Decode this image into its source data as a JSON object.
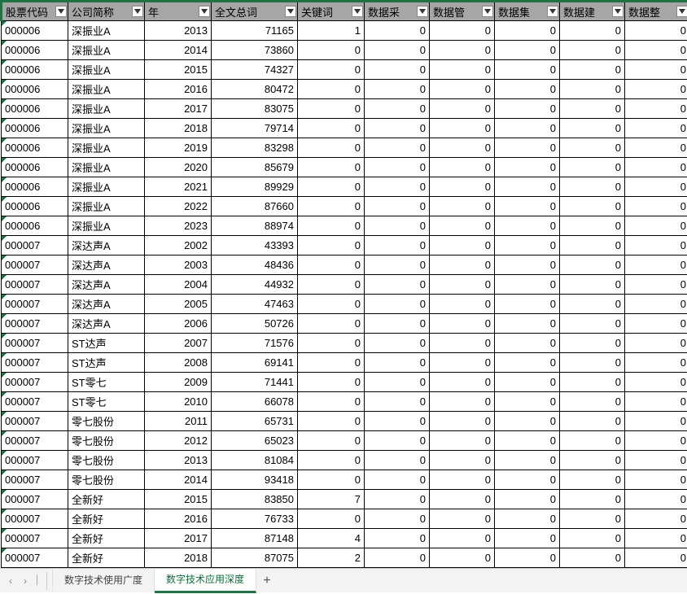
{
  "columns": [
    {
      "key": "code",
      "label": "股票代码",
      "cls": "col-code"
    },
    {
      "key": "name",
      "label": "公司简称",
      "cls": "col-name"
    },
    {
      "key": "year",
      "label": "年",
      "cls": "col-year"
    },
    {
      "key": "words",
      "label": "全文总词",
      "cls": "col-words"
    },
    {
      "key": "kw",
      "label": "关键词",
      "cls": "col-kw"
    },
    {
      "key": "d1",
      "label": "数据采",
      "cls": "col-d"
    },
    {
      "key": "d2",
      "label": "数据管",
      "cls": "col-d"
    },
    {
      "key": "d3",
      "label": "数据集",
      "cls": "col-d"
    },
    {
      "key": "d4",
      "label": "数据建",
      "cls": "col-d"
    },
    {
      "key": "d5",
      "label": "数据整",
      "cls": "col-d"
    }
  ],
  "rows": [
    {
      "code": "000006",
      "name": "深振业A",
      "year": 2013,
      "words": 71165,
      "kw": 1,
      "d1": 0,
      "d2": 0,
      "d3": 0,
      "d4": 0,
      "d5": 0
    },
    {
      "code": "000006",
      "name": "深振业A",
      "year": 2014,
      "words": 73860,
      "kw": 0,
      "d1": 0,
      "d2": 0,
      "d3": 0,
      "d4": 0,
      "d5": 0
    },
    {
      "code": "000006",
      "name": "深振业A",
      "year": 2015,
      "words": 74327,
      "kw": 0,
      "d1": 0,
      "d2": 0,
      "d3": 0,
      "d4": 0,
      "d5": 0
    },
    {
      "code": "000006",
      "name": "深振业A",
      "year": 2016,
      "words": 80472,
      "kw": 0,
      "d1": 0,
      "d2": 0,
      "d3": 0,
      "d4": 0,
      "d5": 0
    },
    {
      "code": "000006",
      "name": "深振业A",
      "year": 2017,
      "words": 83075,
      "kw": 0,
      "d1": 0,
      "d2": 0,
      "d3": 0,
      "d4": 0,
      "d5": 0
    },
    {
      "code": "000006",
      "name": "深振业A",
      "year": 2018,
      "words": 79714,
      "kw": 0,
      "d1": 0,
      "d2": 0,
      "d3": 0,
      "d4": 0,
      "d5": 0
    },
    {
      "code": "000006",
      "name": "深振业A",
      "year": 2019,
      "words": 83298,
      "kw": 0,
      "d1": 0,
      "d2": 0,
      "d3": 0,
      "d4": 0,
      "d5": 0
    },
    {
      "code": "000006",
      "name": "深振业A",
      "year": 2020,
      "words": 85679,
      "kw": 0,
      "d1": 0,
      "d2": 0,
      "d3": 0,
      "d4": 0,
      "d5": 0
    },
    {
      "code": "000006",
      "name": "深振业A",
      "year": 2021,
      "words": 89929,
      "kw": 0,
      "d1": 0,
      "d2": 0,
      "d3": 0,
      "d4": 0,
      "d5": 0
    },
    {
      "code": "000006",
      "name": "深振业A",
      "year": 2022,
      "words": 87660,
      "kw": 0,
      "d1": 0,
      "d2": 0,
      "d3": 0,
      "d4": 0,
      "d5": 0
    },
    {
      "code": "000006",
      "name": "深振业A",
      "year": 2023,
      "words": 88974,
      "kw": 0,
      "d1": 0,
      "d2": 0,
      "d3": 0,
      "d4": 0,
      "d5": 0
    },
    {
      "code": "000007",
      "name": "深达声A",
      "year": 2002,
      "words": 43393,
      "kw": 0,
      "d1": 0,
      "d2": 0,
      "d3": 0,
      "d4": 0,
      "d5": 0
    },
    {
      "code": "000007",
      "name": "深达声A",
      "year": 2003,
      "words": 48436,
      "kw": 0,
      "d1": 0,
      "d2": 0,
      "d3": 0,
      "d4": 0,
      "d5": 0
    },
    {
      "code": "000007",
      "name": "深达声A",
      "year": 2004,
      "words": 44932,
      "kw": 0,
      "d1": 0,
      "d2": 0,
      "d3": 0,
      "d4": 0,
      "d5": 0
    },
    {
      "code": "000007",
      "name": "深达声A",
      "year": 2005,
      "words": 47463,
      "kw": 0,
      "d1": 0,
      "d2": 0,
      "d3": 0,
      "d4": 0,
      "d5": 0
    },
    {
      "code": "000007",
      "name": "深达声A",
      "year": 2006,
      "words": 50726,
      "kw": 0,
      "d1": 0,
      "d2": 0,
      "d3": 0,
      "d4": 0,
      "d5": 0
    },
    {
      "code": "000007",
      "name": "ST达声",
      "year": 2007,
      "words": 71576,
      "kw": 0,
      "d1": 0,
      "d2": 0,
      "d3": 0,
      "d4": 0,
      "d5": 0
    },
    {
      "code": "000007",
      "name": "ST达声",
      "year": 2008,
      "words": 69141,
      "kw": 0,
      "d1": 0,
      "d2": 0,
      "d3": 0,
      "d4": 0,
      "d5": 0
    },
    {
      "code": "000007",
      "name": "ST零七",
      "year": 2009,
      "words": 71441,
      "kw": 0,
      "d1": 0,
      "d2": 0,
      "d3": 0,
      "d4": 0,
      "d5": 0
    },
    {
      "code": "000007",
      "name": "ST零七",
      "year": 2010,
      "words": 66078,
      "kw": 0,
      "d1": 0,
      "d2": 0,
      "d3": 0,
      "d4": 0,
      "d5": 0
    },
    {
      "code": "000007",
      "name": "零七股份",
      "year": 2011,
      "words": 65731,
      "kw": 0,
      "d1": 0,
      "d2": 0,
      "d3": 0,
      "d4": 0,
      "d5": 0
    },
    {
      "code": "000007",
      "name": "零七股份",
      "year": 2012,
      "words": 65023,
      "kw": 0,
      "d1": 0,
      "d2": 0,
      "d3": 0,
      "d4": 0,
      "d5": 0
    },
    {
      "code": "000007",
      "name": "零七股份",
      "year": 2013,
      "words": 81084,
      "kw": 0,
      "d1": 0,
      "d2": 0,
      "d3": 0,
      "d4": 0,
      "d5": 0
    },
    {
      "code": "000007",
      "name": "零七股份",
      "year": 2014,
      "words": 93418,
      "kw": 0,
      "d1": 0,
      "d2": 0,
      "d3": 0,
      "d4": 0,
      "d5": 0
    },
    {
      "code": "000007",
      "name": "全新好",
      "year": 2015,
      "words": 83850,
      "kw": 7,
      "d1": 0,
      "d2": 0,
      "d3": 0,
      "d4": 0,
      "d5": 0
    },
    {
      "code": "000007",
      "name": "全新好",
      "year": 2016,
      "words": 76733,
      "kw": 0,
      "d1": 0,
      "d2": 0,
      "d3": 0,
      "d4": 0,
      "d5": 0
    },
    {
      "code": "000007",
      "name": "全新好",
      "year": 2017,
      "words": 87148,
      "kw": 4,
      "d1": 0,
      "d2": 0,
      "d3": 0,
      "d4": 0,
      "d5": 0
    },
    {
      "code": "000007",
      "name": "全新好",
      "year": 2018,
      "words": 87075,
      "kw": 2,
      "d1": 0,
      "d2": 0,
      "d3": 0,
      "d4": 0,
      "d5": 0
    }
  ],
  "tabs": {
    "items": [
      "数字技术使用广度",
      "数字技术应用深度"
    ],
    "active": 1,
    "add": "+"
  },
  "nav": {
    "prev": "‹",
    "next": "›",
    "jump": "⏐"
  },
  "colors": {
    "accent": "#217346",
    "headerbg": "#a6a6a6"
  }
}
